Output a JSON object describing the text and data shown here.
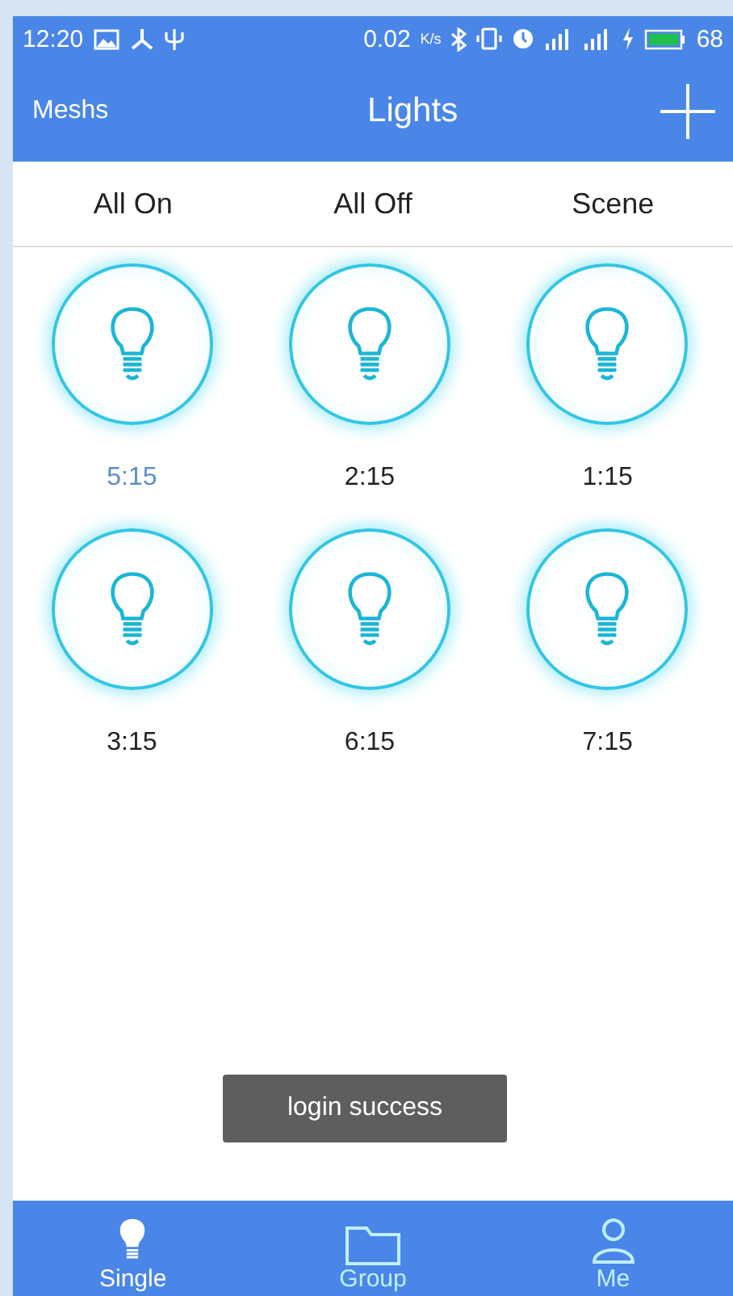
{
  "status_bar": {
    "time": "12:20",
    "speed": "0.02",
    "speed_unit": "K/s",
    "battery": "68"
  },
  "header": {
    "left": "Meshs",
    "title": "Lights"
  },
  "actions": [
    "All On",
    "All Off",
    "Scene"
  ],
  "lights": [
    {
      "label": "5:15",
      "selected": true
    },
    {
      "label": "2:15",
      "selected": false
    },
    {
      "label": "1:15",
      "selected": false
    },
    {
      "label": "3:15",
      "selected": false
    },
    {
      "label": "6:15",
      "selected": false
    },
    {
      "label": "7:15",
      "selected": false
    }
  ],
  "toast": "login success",
  "tabs": [
    {
      "label": "Single",
      "kind": "bulb",
      "selected": true
    },
    {
      "label": "Group",
      "kind": "folder",
      "selected": false
    },
    {
      "label": "Me",
      "kind": "person",
      "selected": false
    }
  ]
}
